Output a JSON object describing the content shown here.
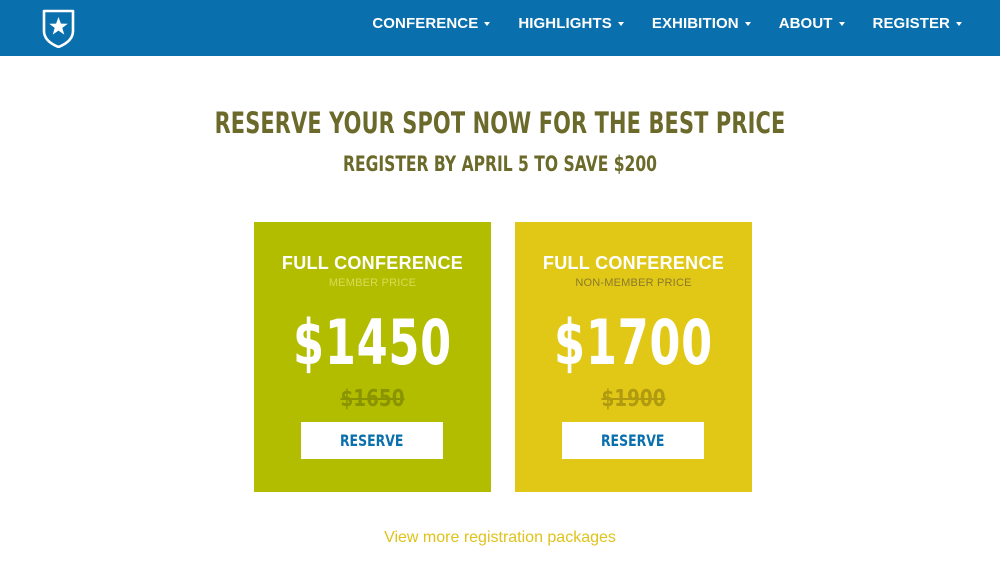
{
  "nav": {
    "logo_icon": "shield-star-icon",
    "items": [
      {
        "label": "CONFERENCE"
      },
      {
        "label": "HIGHLIGHTS"
      },
      {
        "label": "EXHIBITION"
      },
      {
        "label": "ABOUT"
      },
      {
        "label": "REGISTER"
      }
    ]
  },
  "hero": {
    "headline": "RESERVE YOUR SPOT NOW FOR THE BEST PRICE",
    "subheadline": "REGISTER BY APRIL 5 TO SAVE $200"
  },
  "pricing": [
    {
      "title": "FULL CONFERENCE",
      "subtitle": "MEMBER PRICE",
      "price": "$1450",
      "old_price": "$1650",
      "button": "RESERVE",
      "color": "#b2bd00"
    },
    {
      "title": "FULL CONFERENCE",
      "subtitle": "NON-MEMBER PRICE",
      "price": "$1700",
      "old_price": "$1900",
      "button": "RESERVE",
      "color": "#e2c816"
    }
  ],
  "more_link": "View more registration packages",
  "colors": {
    "nav_bg": "#0a6fad",
    "headline": "#6b6a2a",
    "link": "#e0c21a"
  }
}
